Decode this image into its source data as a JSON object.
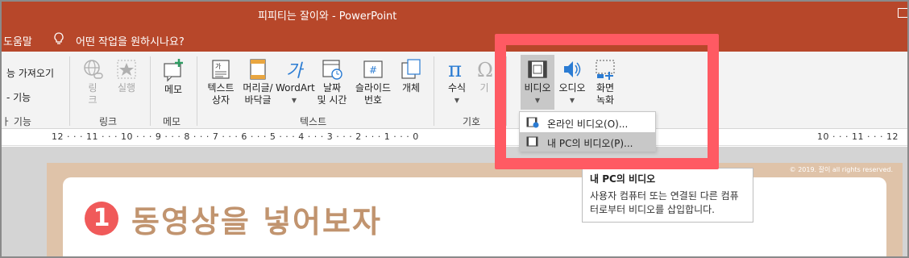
{
  "window": {
    "title": "피피티는 잘이와  -  PowerPoint"
  },
  "menubar": {
    "help": "도움말",
    "tell_me": "어떤 작업을 원하시나요?"
  },
  "ribbon": {
    "left_partial": {
      "item1": "능 가져오기",
      "item2": "- 기능",
      "item3": "ㅏ 기능"
    },
    "links": {
      "link_label": "링\n크",
      "action_label": "실행",
      "group": "링크"
    },
    "memo": {
      "label": "메모",
      "group": "메모"
    },
    "text": {
      "textbox": "텍스트\n상자",
      "header_footer": "머리글/\n바닥글",
      "wordart": "WordArt",
      "datetime": "날짜\n및 시간",
      "slide_number": "슬라이드\n번호",
      "object": "개체",
      "group": "텍스트"
    },
    "symbols": {
      "equation": "수식",
      "symbol_partial": "기",
      "group": "기호"
    },
    "media": {
      "video": "비디오",
      "audio": "오디오",
      "screen_recording": "화면\n녹화"
    }
  },
  "dropdown": {
    "items": [
      {
        "label": "온라인 비디오(O)...",
        "icon": "online-video-icon"
      },
      {
        "label": "내 PC의 비디오(P)...",
        "icon": "pc-video-icon"
      }
    ]
  },
  "tooltip": {
    "title": "내 PC의 비디오",
    "body": "사용자 컴퓨터 또는 연결된 다른 컴퓨터로부터 비디오를 삽입합니다."
  },
  "ruler": {
    "left": "12 · · · 11 · · · 10 · · · 9 · · · 8 · · · 7 · · · 6 · · · 5 · · · 4 · · · 3 · · · 2 · · · 1 · · · 0",
    "right": "10 · · · 11 · · · 12"
  },
  "slide": {
    "number": "1",
    "title": "동영상을 넣어보자",
    "copyright": "© 2019. 잘이 all rights reserved."
  },
  "colors": {
    "accent": "#b7472a",
    "highlight": "#ff5a63",
    "slide_bg": "#dfc3a9",
    "title_color": "#c1946f"
  }
}
